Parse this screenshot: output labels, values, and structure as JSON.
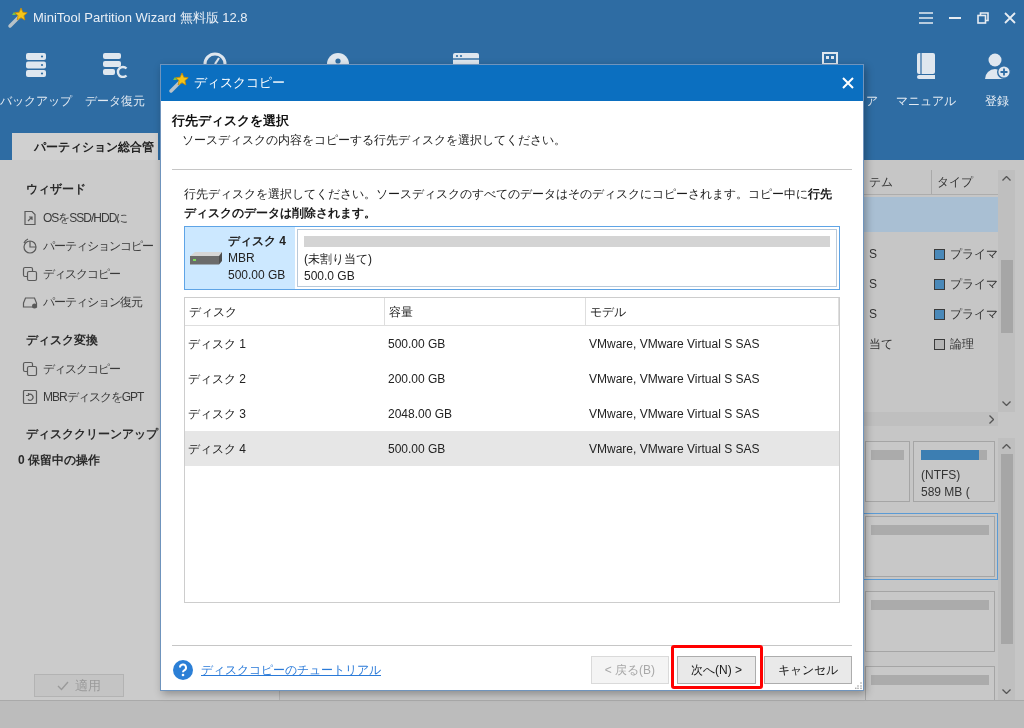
{
  "window": {
    "title": "MiniTool Partition Wizard 無料版 12.8"
  },
  "toolbar": [
    {
      "kind": "backup",
      "label": "バックアップ"
    },
    {
      "kind": "recovery",
      "label": "データ復元"
    },
    {
      "kind": "gauge"
    },
    {
      "kind": "disc"
    },
    {
      "kind": "analyzer"
    },
    {
      "kind": "usb",
      "label": "ア"
    },
    {
      "kind": "manual",
      "label": "マニュアル"
    },
    {
      "kind": "register",
      "label": "登録"
    }
  ],
  "tabs": [
    {
      "label": "パーティション総合管",
      "selected": true
    }
  ],
  "sidebar": {
    "sections": [
      {
        "title": "ウィザード",
        "items": [
          {
            "kind": "migrate",
            "label": "OSをSSD/HDDに"
          },
          {
            "kind": "partition_copy",
            "label": "パーティションコピー"
          },
          {
            "kind": "disk_copy",
            "label": "ディスクコピー"
          },
          {
            "kind": "partition_recovery",
            "label": "パーティション復元"
          }
        ]
      },
      {
        "title": "ディスク変換",
        "items": [
          {
            "kind": "disk_copy",
            "label": "ディスクコピー"
          },
          {
            "kind": "convert",
            "label": "MBRディスクをGPT"
          }
        ]
      },
      {
        "title": "ディスククリーンアップ"
      }
    ],
    "pending": "0 保留中の操作",
    "apply_button": {
      "label": "適用",
      "disabled": true
    }
  },
  "partition_table": {
    "columns": [
      "テム",
      "タイプ"
    ],
    "rows": [
      {
        "kind": "disk",
        "selected": true
      },
      {
        "kind": "partition",
        "selected": false,
        "file_system": "S",
        "type": "プライマ",
        "color": "#4a89b9"
      },
      {
        "kind": "partition",
        "selected": false,
        "file_system": "S",
        "type": "プライマ",
        "color": "#4a89b9"
      },
      {
        "kind": "partition",
        "selected": false,
        "file_system": "S",
        "type": "プライマ",
        "color": "#4a89b9"
      },
      {
        "kind": "partition",
        "selected": false,
        "file_system": "当て",
        "type": "論理",
        "color": "#b4b4b4"
      }
    ]
  },
  "disk_map": {
    "disks": [
      {
        "selected": false,
        "partitions": [
          {
            "kind": "plain"
          },
          {
            "kind": "used",
            "file_system": "(NTFS)",
            "size": "589 MB (",
            "level": 0.88
          }
        ]
      },
      {
        "selected": true,
        "partitions": [
          {
            "kind": "plain"
          }
        ]
      },
      {
        "selected": false,
        "partitions": [
          {
            "kind": "plain"
          }
        ]
      },
      {
        "selected": false,
        "partitions": [
          {
            "kind": "plain"
          }
        ]
      }
    ]
  },
  "dialog": {
    "title": "ディスクコピー",
    "heading": "行先ディスクを選択",
    "subtitle": "ソースディスクの内容をコピーする行先ディスクを選択してください。",
    "description": "行先ディスクを選択してください。ソースディスクのすべてのデータはそのディスクにコピーされます。コピー中に**行先ディスクのデータは削除されます。**",
    "disk_card": {
      "selected": true,
      "name": "ディスク 4",
      "scheme": "MBR",
      "size": "500.00 GB",
      "partitions": [
        {
          "label": "(未割り当て)",
          "size": "500.0 GB"
        }
      ]
    },
    "table": {
      "columns": [
        "ディスク",
        "容量",
        "モデル"
      ],
      "rows": [
        {
          "disk": "ディスク 1",
          "capacity": "500.00 GB",
          "model": "VMware, VMware Virtual S SAS",
          "selected": false
        },
        {
          "disk": "ディスク 2",
          "capacity": "200.00 GB",
          "model": "VMware, VMware Virtual S SAS",
          "selected": false
        },
        {
          "disk": "ディスク 3",
          "capacity": "2048.00 GB",
          "model": "VMware, VMware Virtual S SAS",
          "selected": false
        },
        {
          "disk": "ディスク 4",
          "capacity": "500.00 GB",
          "model": "VMware, VMware Virtual S SAS",
          "selected": true
        }
      ]
    },
    "help_link": "ディスクコピーのチュートリアル",
    "buttons": [
      {
        "label": "< 戻る(B)",
        "disabled": true,
        "highlighted": false
      },
      {
        "label": "次へ(N) >",
        "disabled": false,
        "highlighted": true
      },
      {
        "label": "キャンセル",
        "disabled": false,
        "highlighted": false
      }
    ]
  }
}
